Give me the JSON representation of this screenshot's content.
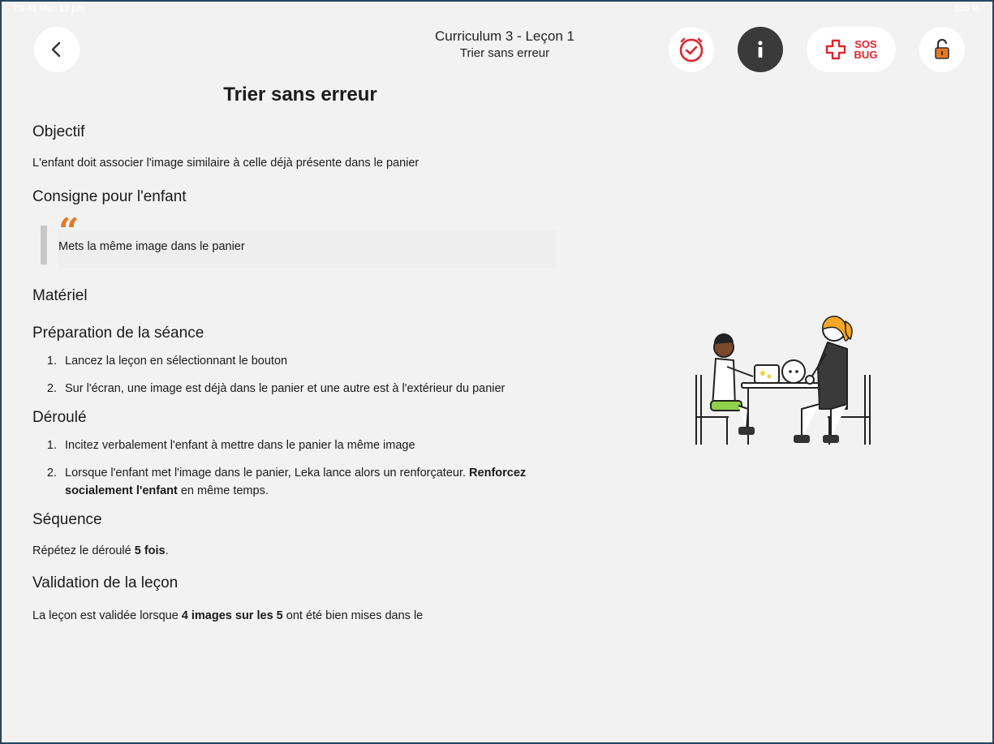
{
  "status_bar": {
    "left": "09:41 Mer. 12 juin",
    "right": "100 %"
  },
  "nav": {
    "title": "Curriculum 3 - Leçon 1",
    "subtitle": "Trier sans erreur",
    "sos_line1": "SOS",
    "sos_line2": "BUG"
  },
  "lesson": {
    "title": "Trier sans erreur",
    "objectif_heading": "Objectif",
    "objectif_text": "L'enfant doit associer l'image similaire à celle déjà présente dans le panier",
    "consigne_heading": "Consigne pour l'enfant",
    "consigne_quote_mark": "“",
    "consigne_text": "Mets la même image dans le panier",
    "materiel_heading": "Matériel",
    "preparation_heading": "Préparation de la séance",
    "preparation_steps": [
      "Lancez la leçon en sélectionnant le bouton",
      "Sur l'écran, une image est déjà dans le panier et une autre est à l'extérieur du panier"
    ],
    "deroule_heading": "Déroulé",
    "deroule_step1": "Incitez verbalement l'enfant à mettre dans le panier la même image",
    "deroule_step2_a": "Lorsque l'enfant met l'image dans le panier, Leka lance alors un renforçateur. ",
    "deroule_step2_bold": "Renforcez socialement l'enfant",
    "deroule_step2_b": " en même temps.",
    "sequence_heading": "Séquence",
    "sequence_a": "Répétez le déroulé ",
    "sequence_bold": "5 fois",
    "sequence_b": ".",
    "validation_heading": "Validation de la leçon",
    "validation_a": "La leçon est validée lorsque ",
    "validation_bold": "4 images sur les 5",
    "validation_b": " ont été bien mises dans le"
  },
  "colors": {
    "accent_red": "#e0262e",
    "quote_orange": "#e87722",
    "lock_orange": "#e87722",
    "info_dark": "#3a3a3a",
    "background": "#f2f2f2"
  },
  "icons": {
    "back": "chevron-left-icon",
    "timer": "clock-check-icon",
    "info": "info-icon",
    "sos": "medical-cross-icon",
    "lock": "unlocked-padlock-icon"
  }
}
